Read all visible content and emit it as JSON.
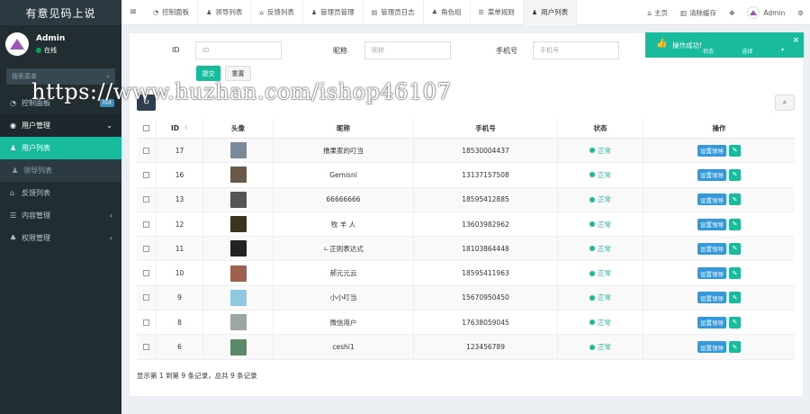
{
  "sidebar": {
    "brand": "有意见码上说",
    "user_name": "Admin",
    "user_status": "在线",
    "search_placeholder": "搜索菜单",
    "items": [
      {
        "label": "控制面板",
        "badge": "hot",
        "icon": "dashboard-icon"
      },
      {
        "label": "用户管理",
        "icon": "user-circle-icon"
      },
      {
        "label": "用户列表",
        "icon": "user-icon"
      },
      {
        "label": "领导列表",
        "icon": "user-icon"
      },
      {
        "label": "反馈列表",
        "icon": "bank-icon"
      },
      {
        "label": "内容管理",
        "icon": "list-icon"
      },
      {
        "label": "权限管理",
        "icon": "group-icon"
      }
    ]
  },
  "navbar": {
    "tabs": [
      {
        "label": "控制面板"
      },
      {
        "label": "领导列表"
      },
      {
        "label": "反馈列表"
      },
      {
        "label": "管理员管理"
      },
      {
        "label": "管理员日志"
      },
      {
        "label": "角色组"
      },
      {
        "label": "菜单规则"
      },
      {
        "label": "用户列表"
      }
    ],
    "home": "主页",
    "clear_cache": "清除缓存",
    "admin": "Admin"
  },
  "filter": {
    "id_label": "ID",
    "id_placeholder": "ID",
    "nick_label": "昵称",
    "nick_placeholder": "昵称",
    "mobile_label": "手机号",
    "mobile_placeholder": "手机号",
    "submit": "提交",
    "reset": "重置"
  },
  "table": {
    "headers": {
      "id": "ID",
      "avatar": "头像",
      "nickname": "昵称",
      "mobile": "手机号",
      "status": "状态",
      "operate": "操作"
    },
    "rows": [
      {
        "id": "17",
        "nickname": "撸果家的叮当",
        "mobile": "18530004437",
        "status": "正常",
        "thumb": "#7a8a9a"
      },
      {
        "id": "16",
        "nickname": "Gemisni",
        "mobile": "13137157508",
        "status": "正常",
        "thumb": "#6b5a4a"
      },
      {
        "id": "13",
        "nickname": "66666666",
        "mobile": "18595412885",
        "status": "正常",
        "thumb": "#555555"
      },
      {
        "id": "12",
        "nickname": "牧 羊 人",
        "mobile": "13603982962",
        "status": "正常",
        "thumb": "#3a3320"
      },
      {
        "id": "11",
        "nickname": "ㄴ正则表达式",
        "mobile": "18103864448",
        "status": "正常",
        "thumb": "#222222"
      },
      {
        "id": "10",
        "nickname": "郝元元云",
        "mobile": "18595411963",
        "status": "正常",
        "thumb": "#a06050"
      },
      {
        "id": "9",
        "nickname": "小小叮当",
        "mobile": "15670950450",
        "status": "正常",
        "thumb": "#8fc9e0"
      },
      {
        "id": "8",
        "nickname": "微信用户",
        "mobile": "17638059045",
        "status": "正常",
        "thumb": "#9aa8a0"
      },
      {
        "id": "6",
        "nickname": "ceshi1",
        "mobile": "123456789",
        "status": "正常",
        "thumb": "#5a8a6a"
      }
    ],
    "op_label": "设置领导"
  },
  "summary": "显示第 1 到第 9 条记录，总共 9 条记录",
  "toast": {
    "message": "操作成功!",
    "select_label": "状态",
    "select_value": "选择"
  },
  "watermark": "https://www.huzhan.com/ishop46107",
  "colors": {
    "sidebar_bg": "#222d32",
    "accent": "#18bc9c",
    "op_button": "#3498db"
  }
}
